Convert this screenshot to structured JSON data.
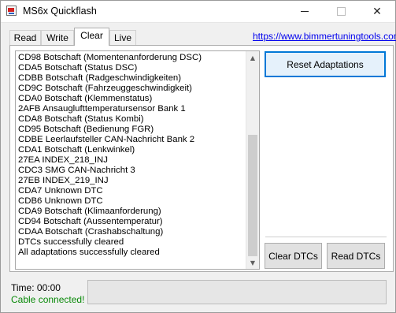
{
  "window": {
    "title": "MS6x Quickflash",
    "icon": "app-icon",
    "controls": [
      "minimize-icon",
      "maximize-icon",
      "close-icon"
    ]
  },
  "tabs": [
    {
      "label": "Read",
      "active": false
    },
    {
      "label": "Write",
      "active": false
    },
    {
      "label": "Clear",
      "active": true
    },
    {
      "label": "Live",
      "active": false
    }
  ],
  "header": {
    "link": "https://www.bimmertuningtools.com"
  },
  "log": {
    "lines": [
      "CD98 Botschaft (Momentenanforderung DSC)",
      "CDA5 Botschaft (Status DSC)",
      "CDBB Botschaft (Radgeschwindigkeiten)",
      "CD9C Botschaft (Fahrzeuggeschwindigkeit)",
      "CDA0 Botschaft (Klemmenstatus)",
      "2AFB Ansauglufttemperatursensor Bank 1",
      "CDA8 Botschaft (Status Kombi)",
      "CD95 Botschaft (Bedienung FGR)",
      "CDBE Leerlaufsteller CAN-Nachricht Bank 2",
      "CDA1 Botschaft (Lenkwinkel)",
      "27EA INDEX_218_INJ",
      "CDC3 SMG CAN-Nachricht 3",
      "27EB INDEX_219_INJ",
      "CDA7 Unknown DTC",
      "CDB6 Unknown DTC",
      "CDA9 Botschaft (Klimaanforderung)",
      "CD94 Botschaft (Aussentemperatur)",
      "CDAA Botschaft (Crashabschaltung)",
      "DTCs successfully cleared",
      "All adaptations successfully cleared"
    ],
    "scrollbar": {
      "up_icon": "chevron-up-icon",
      "down_icon": "chevron-down-icon"
    }
  },
  "buttons": {
    "reset_adaptations": "Reset Adaptations",
    "clear_dtcs": "Clear DTCs",
    "read_dtcs": "Read DTCs"
  },
  "footer": {
    "time": "Time: 00:00",
    "status": "Cable connected!",
    "status_color": "#0a8a0a",
    "progress": 0
  }
}
